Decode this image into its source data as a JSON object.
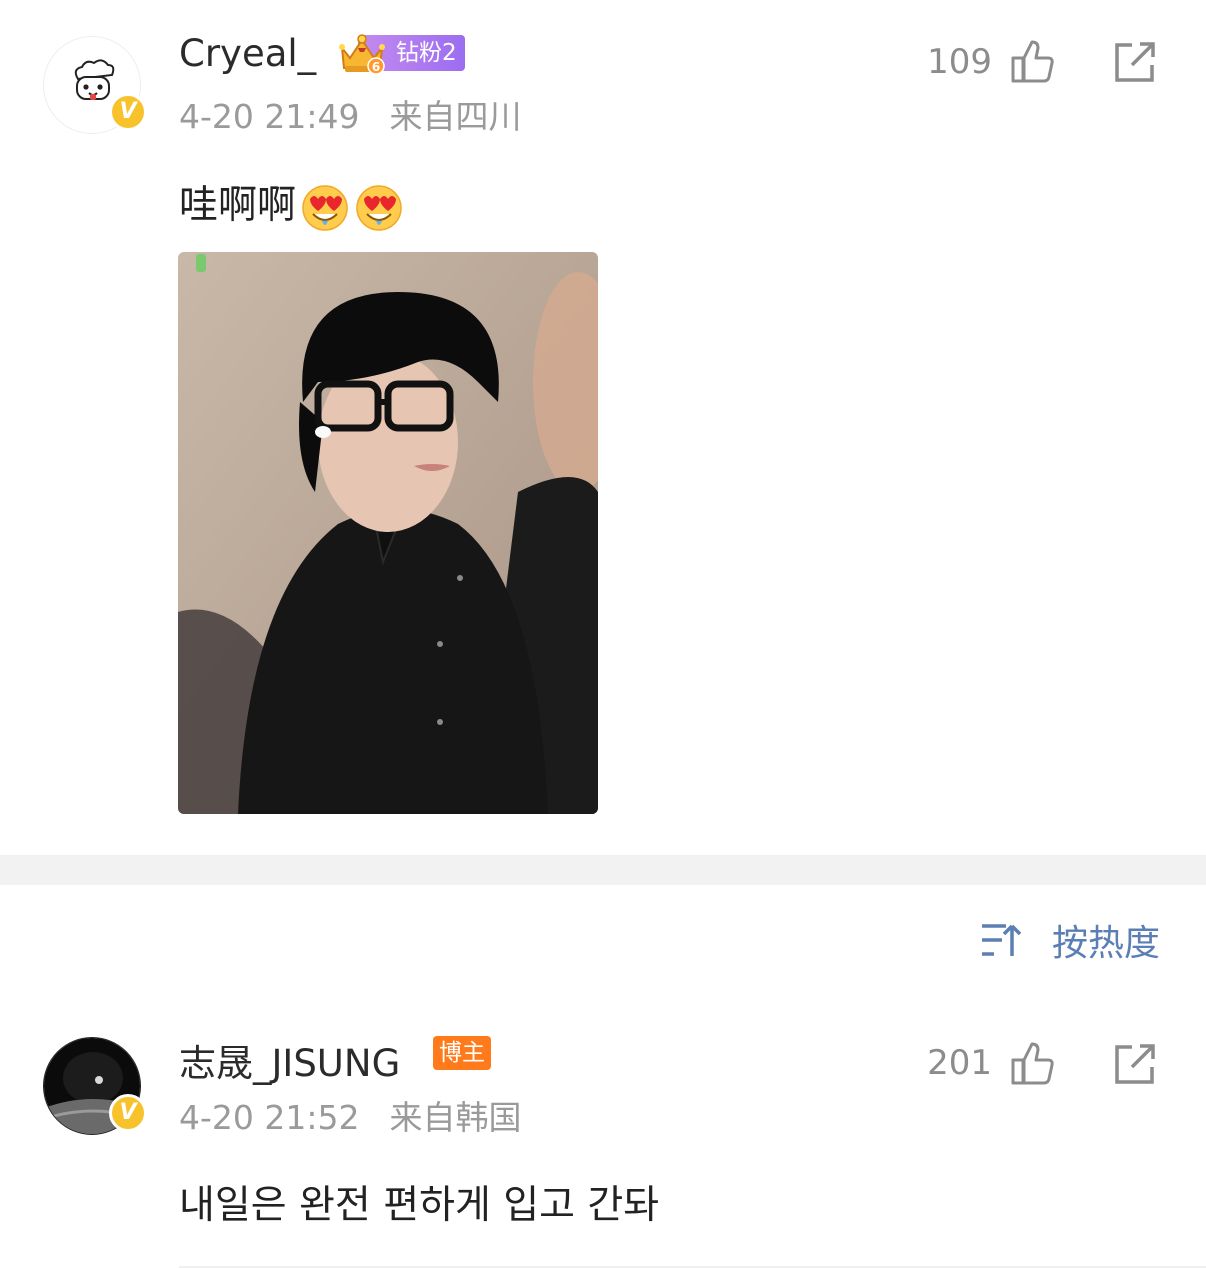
{
  "post": {
    "username": "Cryeal_",
    "fan_badge_level": "6",
    "fan_badge_label": "钻粉2",
    "timestamp": "4-20 21:49",
    "location": "来自四川",
    "like_count": "109",
    "text": "哇啊啊",
    "emoji_count": 2
  },
  "sort": {
    "label": "按热度"
  },
  "comment": {
    "username": "志晟_JISUNG",
    "role_badge": "博主",
    "timestamp": "4-20 21:52",
    "location": "来自韩国",
    "like_count": "201",
    "text": "내일은 완전 편하게 입고 간돠"
  },
  "colors": {
    "verified_badge": "#f8c22b",
    "fan_badge": "#a77bf0",
    "blogger_badge": "#ff7a1a",
    "sort_link": "#5b7fb4",
    "meta_text": "#9a9a9a"
  },
  "icons": [
    "verified-icon",
    "fan-crown-icon",
    "thumbs-up-icon",
    "share-icon",
    "sort-icon",
    "heart-eyes-emoji"
  ]
}
